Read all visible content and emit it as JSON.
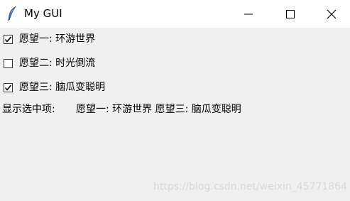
{
  "window": {
    "title": "My GUI",
    "feather_icon": "feather-icon",
    "controls": {
      "minimize_icon": "minimize-icon",
      "maximize_icon": "maximize-icon",
      "close_icon": "close-icon"
    }
  },
  "checkboxes": [
    {
      "label": "愿望一: 环游世界",
      "checked": true
    },
    {
      "label": "愿望二: 时光倒流",
      "checked": false
    },
    {
      "label": "愿望三: 脑瓜变聪明",
      "checked": true
    }
  ],
  "display": {
    "label": "显示选中项:",
    "value": "愿望一: 环游世界 愿望三: 脑瓜变聪明"
  },
  "watermark": "https://blog.csdn.net/weixin_45771864",
  "colors": {
    "titlebar_bg": "#ffffff",
    "client_bg": "#f0f0f0",
    "feather": "#3a6fb0"
  }
}
